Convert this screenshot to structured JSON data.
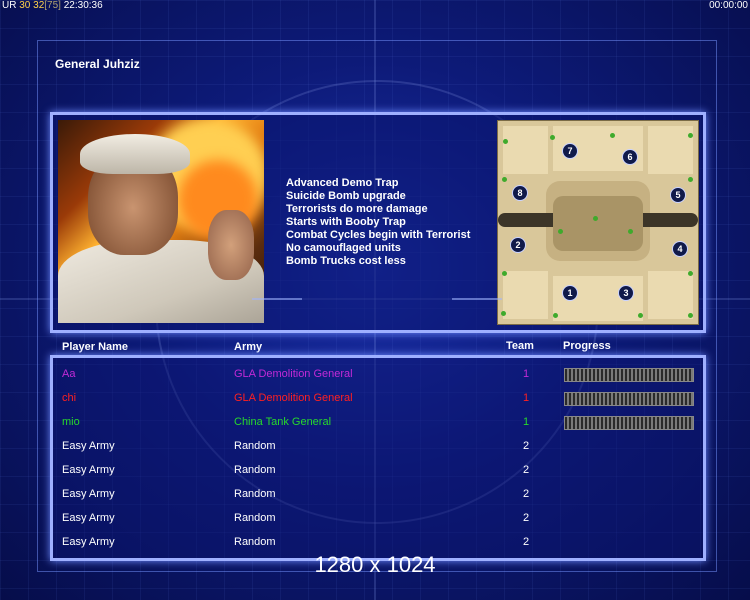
{
  "top_status": {
    "left_prefix": "UR",
    "num1": "30",
    "num2": "32",
    "num3": "[75]",
    "clock": "22:30:36",
    "timer": "00:00:00"
  },
  "general": {
    "name": "General Juhziz",
    "traits": [
      "Advanced Demo Trap",
      "Suicide Bomb upgrade",
      "Terrorists do more damage",
      "Starts with Booby Trap",
      "Combat Cycles begin with Terrorist",
      "No camouflaged units",
      "Bomb Trucks cost less"
    ]
  },
  "minimap": {
    "spawns": [
      "1",
      "2",
      "3",
      "4",
      "5",
      "6",
      "7",
      "8"
    ]
  },
  "columns": {
    "player": "Player Name",
    "army": "Army",
    "team": "Team",
    "progress": "Progress"
  },
  "players": [
    {
      "name": "Aa",
      "army": "GLA Demolition General",
      "team": "1",
      "color": "#c22ad6",
      "progress": 1.0
    },
    {
      "name": "chi",
      "army": "GLA Demolition General",
      "team": "1",
      "color": "#ff2020",
      "progress": 1.0
    },
    {
      "name": "mio",
      "army": "China Tank General",
      "team": "1",
      "color": "#27d82b",
      "progress": 1.0
    },
    {
      "name": "Easy Army",
      "army": "Random",
      "team": "2",
      "color": "#ffffff"
    },
    {
      "name": "Easy Army",
      "army": "Random",
      "team": "2",
      "color": "#ffffff"
    },
    {
      "name": "Easy Army",
      "army": "Random",
      "team": "2",
      "color": "#ffffff"
    },
    {
      "name": "Easy Army",
      "army": "Random",
      "team": "2",
      "color": "#ffffff"
    },
    {
      "name": "Easy Army",
      "army": "Random",
      "team": "2",
      "color": "#ffffff"
    }
  ],
  "resolution": "1280 x 1024"
}
